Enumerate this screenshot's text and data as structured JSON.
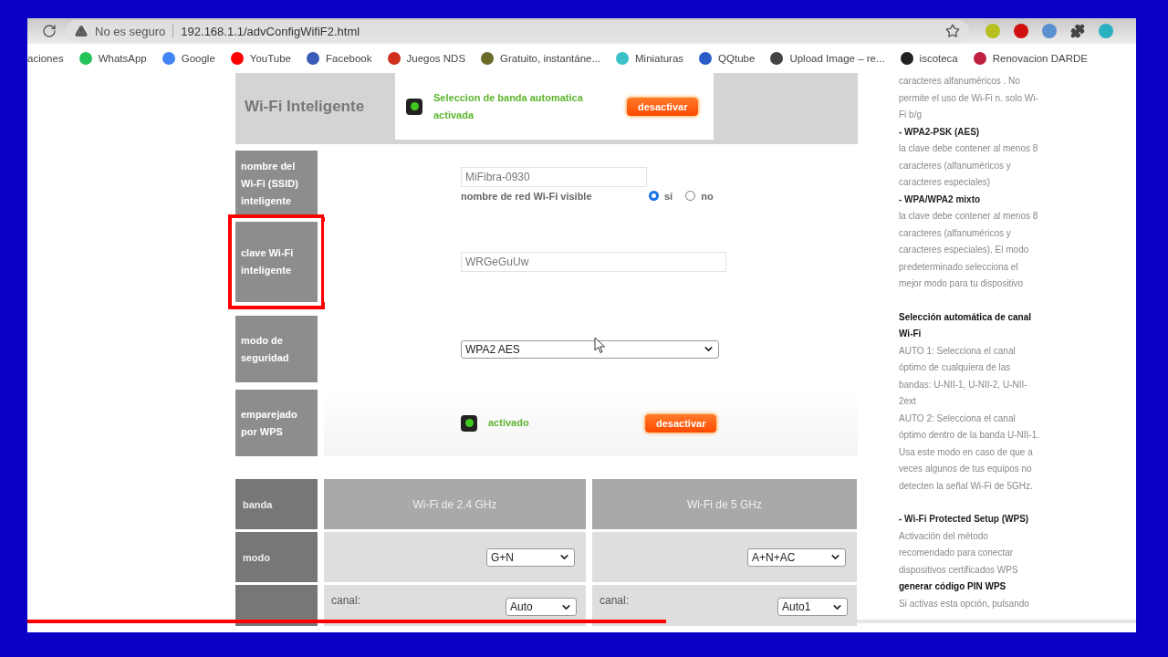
{
  "browser": {
    "security": "No es seguro",
    "url": "192.168.1.1/advConfigWifiF2.html"
  },
  "bookmarks": [
    {
      "label": "aciones"
    },
    {
      "label": "WhatsApp",
      "color": "#25c45a"
    },
    {
      "label": "Google",
      "color": "#4285f4"
    },
    {
      "label": "YouTube",
      "color": "#ff0000"
    },
    {
      "label": "Facebook",
      "color": "#3b5bb8"
    },
    {
      "label": "Juegos NDS",
      "color": "#d0301c"
    },
    {
      "label": "Gratuito, instantáne...",
      "color": "#6b6b2a"
    },
    {
      "label": "Miniaturas",
      "color": "#3cc0c8"
    },
    {
      "label": "QQtube",
      "color": "#2a5cc8"
    },
    {
      "label": "Upload Image – re...",
      "color": "#444444"
    },
    {
      "label": "iscoteca",
      "color": "#222222"
    },
    {
      "label": "Renovacion DARDE",
      "color": "#c02040"
    }
  ],
  "section": {
    "title": "Wi-Fi Inteligente",
    "status": "Seleccion de banda automatica activada",
    "active": true,
    "button": "desactivar"
  },
  "rows": [
    {
      "kind": "ssid",
      "label": "nombre del Wi-Fi (SSID) inteligente",
      "value": "MiFibra-0930",
      "visible_label": "nombre de red Wi-Fi visible",
      "options": [
        {
          "label": "sí",
          "selected": true
        },
        {
          "label": "no",
          "selected": false
        }
      ],
      "highlighted": false
    },
    {
      "kind": "password",
      "label": "clave Wi-Fi inteligente",
      "value": "WRGeGuUw",
      "highlighted": true
    },
    {
      "kind": "select",
      "label": "modo de seguridad",
      "value": "WPA2 AES",
      "highlighted": false
    },
    {
      "kind": "wps",
      "label": "emparejado por WPS",
      "status": "activado",
      "active": true,
      "button": "desactivar",
      "highlighted": false
    }
  ],
  "bands": {
    "label": "banda",
    "columns": [
      "Wi-Fi de 2.4 GHz",
      "Wi-Fi de 5 GHz"
    ],
    "mode": {
      "label": "modo",
      "values": [
        "G+N",
        "A+N+AC"
      ]
    },
    "channel": {
      "cells": [
        {
          "label": "canal:",
          "value": "Auto"
        },
        {
          "label": "canal:",
          "value": "Auto1"
        }
      ]
    }
  },
  "help": [
    [
      {
        "kind": "text",
        "text": "caracteres alfanuméricos . No permite el uso de Wi-Fi n. solo Wi-Fi b/g"
      },
      {
        "kind": "heading",
        "text": "- WPA2-PSK (AES)"
      },
      {
        "kind": "text",
        "text": "la clave debe contener al menos 8 caracteres (alfanuméricos y caracteres especiales)"
      },
      {
        "kind": "heading",
        "text": "- WPA/WPA2 mixto"
      },
      {
        "kind": "text",
        "text": "la clave debe contener al menos 8 caracteres (alfanuméricos y caracteres especiales). El modo predeterminado selecciona el mejor modo para tu dispositivo"
      }
    ],
    [
      {
        "kind": "title",
        "text": "Selección automática de canal Wi-Fi"
      },
      {
        "kind": "text",
        "text": "AUTO 1: Selecciona el canal óptimo de cualquiera de las bandas: U-NII-1, U-NII-2, U-NII-2ext"
      },
      {
        "kind": "text",
        "text": "AUTO 2: Selecciona el canal óptimo dentro de la banda U-NII-1. Usa este modo en caso de que a veces algunos de tus equipos no detecten la señal Wi-Fi de 5GHz."
      }
    ],
    [
      {
        "kind": "heading",
        "text": "- Wi-Fi Protected Setup (WPS)"
      },
      {
        "kind": "text",
        "text": "Activación del método recomendado para conectar dispositivos certificados WPS"
      },
      {
        "kind": "title",
        "text": "generar código PIN WPS"
      },
      {
        "kind": "text",
        "text": "Si activas esta opción, pulsando"
      }
    ]
  ],
  "video": {
    "level": 0.576
  }
}
